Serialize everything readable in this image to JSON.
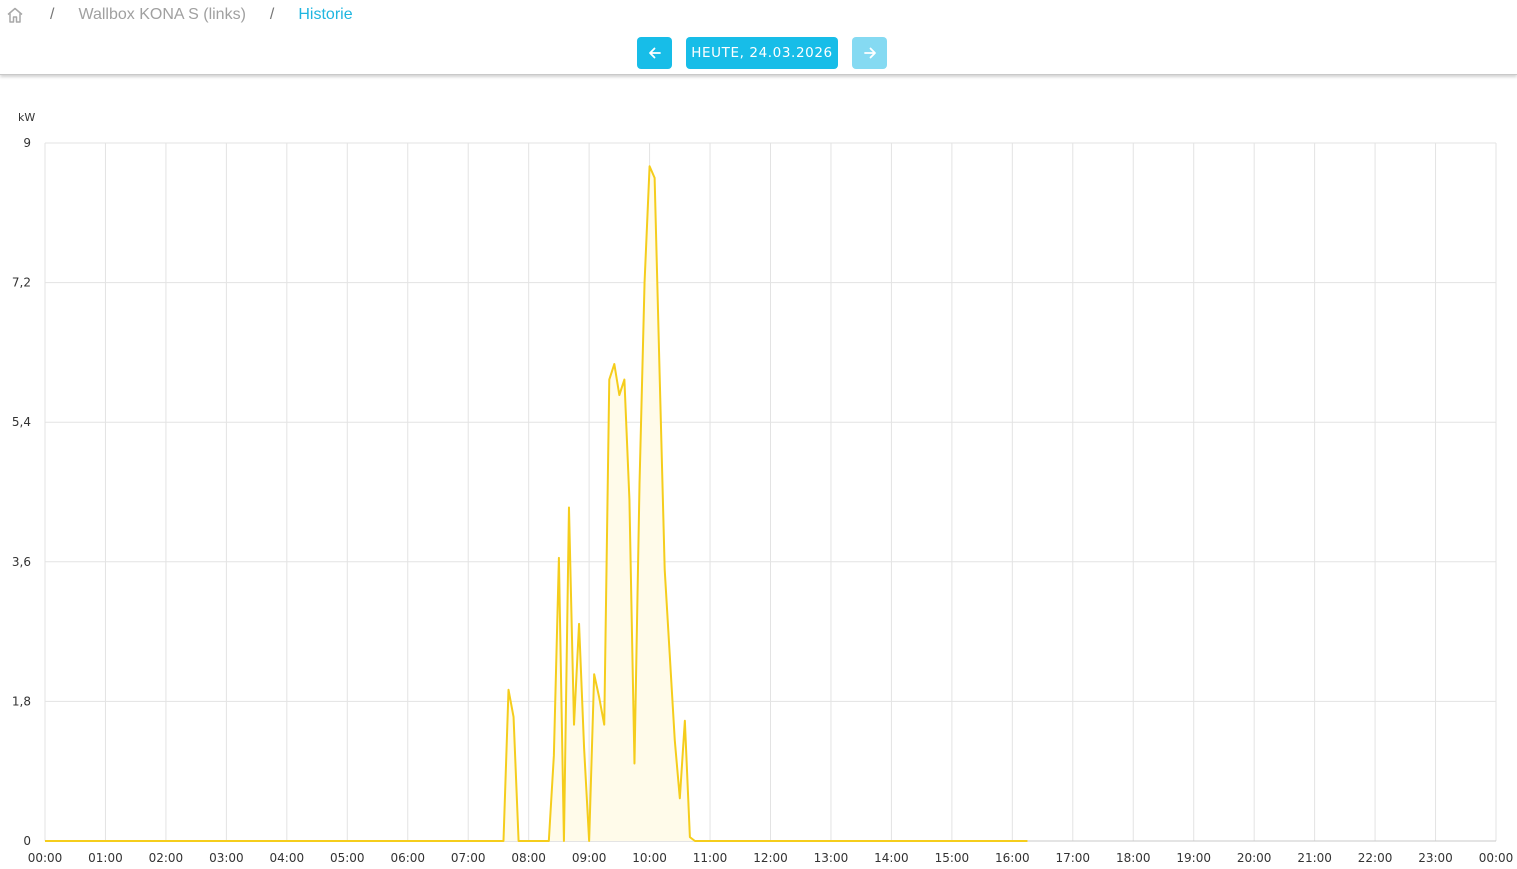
{
  "breadcrumb": {
    "home_icon": "home-icon",
    "separator": "/",
    "device": "Wallbox KONA S (links)",
    "current": "Historie"
  },
  "date_nav": {
    "prev_icon": "arrow-left-icon",
    "next_icon": "arrow-right-icon",
    "date_label": "HEUTE, 24.03.2026",
    "next_disabled": true
  },
  "colors": {
    "accent": "#17bde8",
    "breadcrumb_current": "#1fb6e0",
    "series_line": "#f5cd1c",
    "series_fill": "#fffbea",
    "grid": "#e3e3e3"
  },
  "chart_data": {
    "type": "area",
    "ylabel": "kW",
    "ylim": [
      0,
      9
    ],
    "yticks": [
      "0",
      "1,8",
      "3,6",
      "5,4",
      "7,2",
      "9"
    ],
    "ytick_values": [
      0,
      1.8,
      3.6,
      5.4,
      7.2,
      9
    ],
    "xlim": [
      0,
      24
    ],
    "xticks": [
      "00:00",
      "01:00",
      "02:00",
      "03:00",
      "04:00",
      "05:00",
      "06:00",
      "07:00",
      "08:00",
      "09:00",
      "10:00",
      "11:00",
      "12:00",
      "13:00",
      "14:00",
      "15:00",
      "16:00",
      "17:00",
      "18:00",
      "19:00",
      "20:00",
      "21:00",
      "22:00",
      "23:00",
      "00:00"
    ],
    "grid": true,
    "legend": "none",
    "series": [
      {
        "x": [
          "00:00",
          "07:35",
          "07:40",
          "07:45",
          "07:50",
          "08:20",
          "08:25",
          "08:30",
          "08:35",
          "08:40",
          "08:45",
          "08:50",
          "08:55",
          "09:00",
          "09:05",
          "09:10",
          "09:15",
          "09:20",
          "09:25",
          "09:30",
          "09:35",
          "09:40",
          "09:45",
          "09:50",
          "09:55",
          "10:00",
          "10:05",
          "10:10",
          "10:15",
          "10:20",
          "10:25",
          "10:30",
          "10:35",
          "10:40",
          "10:45",
          "16:15"
        ],
        "y": [
          0,
          0,
          1.95,
          1.6,
          0,
          0,
          1.1,
          3.65,
          0,
          4.3,
          1.5,
          2.8,
          1.2,
          0,
          2.15,
          1.85,
          1.5,
          5.95,
          6.15,
          5.75,
          5.95,
          4.4,
          1.0,
          4.6,
          7.2,
          8.7,
          8.55,
          6.0,
          3.5,
          2.4,
          1.3,
          0.55,
          1.55,
          0.05,
          0,
          0
        ]
      }
    ]
  }
}
